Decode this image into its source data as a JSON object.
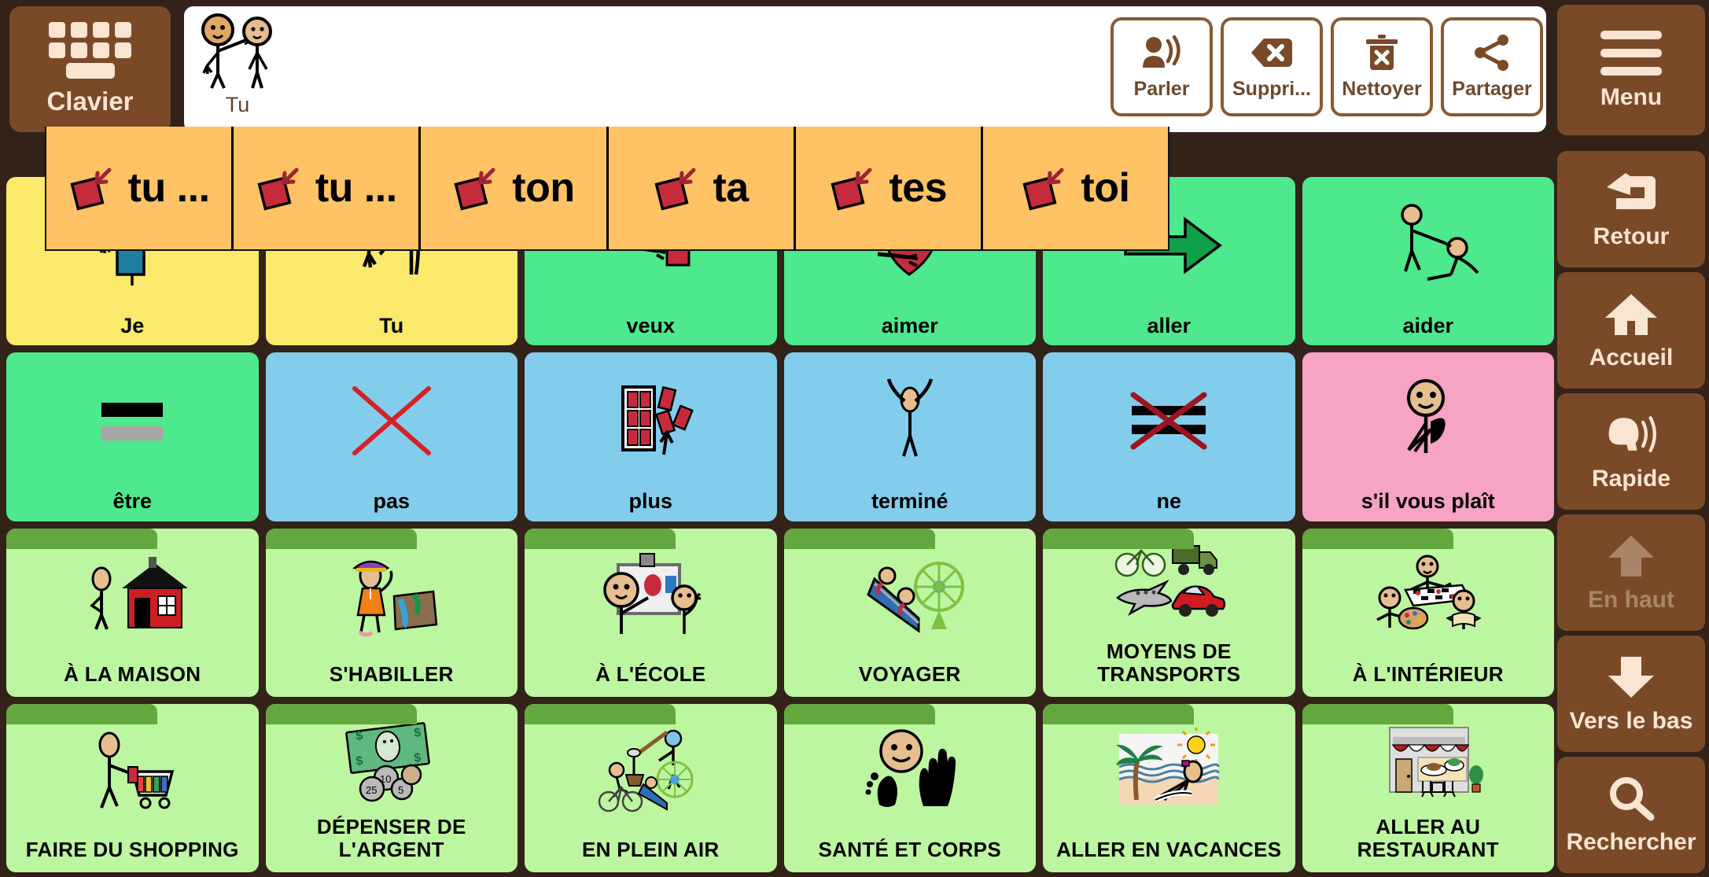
{
  "keyboard_button": {
    "label": "Clavier",
    "icon": "keyboard-icon"
  },
  "sentence_bar": {
    "items": [
      {
        "label": "Tu",
        "icon": "two-people-pointing-icon"
      }
    ]
  },
  "toolbar": {
    "buttons": [
      {
        "label": "Parler",
        "icon": "speak-person-icon"
      },
      {
        "label": "Suppri...",
        "icon": "backspace-delete-icon"
      },
      {
        "label": "Nettoyer",
        "icon": "trash-clear-icon"
      },
      {
        "label": "Partager",
        "icon": "share-icon"
      }
    ]
  },
  "prediction_bar": {
    "background": "#ffc265",
    "items": [
      {
        "label": "tu ...",
        "icon": "red-diamond-arrow-icon"
      },
      {
        "label": "tu ...",
        "icon": "red-diamond-arrow-icon"
      },
      {
        "label": "ton",
        "icon": "red-diamond-arrow-icon"
      },
      {
        "label": "ta",
        "icon": "red-diamond-arrow-icon"
      },
      {
        "label": "tes",
        "icon": "red-diamond-arrow-icon"
      },
      {
        "label": "toi",
        "icon": "red-diamond-arrow-icon"
      }
    ]
  },
  "grid": {
    "columns": 6,
    "rows": 4,
    "cells": [
      {
        "label": "Je",
        "color": "#fbe96b",
        "type": "word",
        "icon": "person-blue-shirt-icon"
      },
      {
        "label": "Tu",
        "color": "#fbe96b",
        "type": "word",
        "icon": "two-stick-arms-icon"
      },
      {
        "label": "veux",
        "color": "#4ee88d",
        "type": "word",
        "icon": "hands-reaching-red-block-icon"
      },
      {
        "label": "aimer",
        "color": "#4ee88d",
        "type": "word",
        "icon": "hands-hugging-heart-icon"
      },
      {
        "label": "aller",
        "color": "#4ee88d",
        "type": "word",
        "icon": "green-right-arrow-icon"
      },
      {
        "label": "aider",
        "color": "#4ee88d",
        "type": "word",
        "icon": "person-helping-person-icon"
      },
      {
        "label": "être",
        "color": "#4ee88d",
        "type": "word",
        "icon": "two-bars-equals-icon"
      },
      {
        "label": "pas",
        "color": "#82cdec",
        "type": "word",
        "icon": "red-x-cross-icon"
      },
      {
        "label": "plus",
        "color": "#82cdec",
        "type": "word",
        "icon": "blocks-adding-icon"
      },
      {
        "label": "terminé",
        "color": "#82cdec",
        "type": "word",
        "icon": "person-arms-up-icon"
      },
      {
        "label": "ne",
        "color": "#82cdec",
        "type": "word",
        "icon": "bars-crossed-out-icon"
      },
      {
        "label": "s'il vous plaît",
        "color": "#f7a3c3",
        "type": "word",
        "icon": "person-please-gesture-icon"
      },
      {
        "label": "À LA MAISON",
        "color": "#bdf6a0",
        "type": "folder",
        "icon": "house-with-person-icon"
      },
      {
        "label": "S'HABILLER",
        "color": "#bdf6a0",
        "type": "folder",
        "icon": "woman-dressing-clothes-icon"
      },
      {
        "label": "À L'ÉCOLE",
        "color": "#bdf6a0",
        "type": "folder",
        "icon": "classroom-whiteboard-icon"
      },
      {
        "label": "VOYAGER",
        "color": "#bdf6a0",
        "type": "folder",
        "icon": "rollercoaster-ferris-wheel-icon"
      },
      {
        "label": "MOYENS DE TRANSPORTS",
        "color": "#bdf6a0",
        "type": "folder",
        "icon": "vehicles-bike-truck-plane-car-icon"
      },
      {
        "label": "À L'INTÉRIEUR",
        "color": "#bdf6a0",
        "type": "folder",
        "icon": "indoor-games-painting-reading-icon"
      },
      {
        "label": "FAIRE DU SHOPPING",
        "color": "#bdf6a0",
        "type": "folder",
        "icon": "person-shopping-cart-icon"
      },
      {
        "label": "DÉPENSER DE L'ARGENT",
        "color": "#bdf6a0",
        "type": "folder",
        "icon": "money-bill-coins-icon"
      },
      {
        "label": "EN PLEIN AIR",
        "color": "#bdf6a0",
        "type": "folder",
        "icon": "outdoor-sports-bike-icon"
      },
      {
        "label": "SANTÉ ET CORPS",
        "color": "#bdf6a0",
        "type": "folder",
        "icon": "face-foot-hand-icon"
      },
      {
        "label": "ALLER EN VACANCES",
        "color": "#bdf6a0",
        "type": "folder",
        "icon": "beach-palm-sun-icon"
      },
      {
        "label": "ALLER AU RESTAURANT",
        "color": "#bdf6a0",
        "type": "folder",
        "icon": "restaurant-storefront-icon"
      }
    ]
  },
  "sidebar": {
    "items": [
      {
        "label": "Menu",
        "icon": "hamburger-menu-icon",
        "disabled": false
      },
      {
        "label": "Retour",
        "icon": "back-arrow-icon",
        "disabled": false
      },
      {
        "label": "Accueil",
        "icon": "home-icon",
        "disabled": false
      },
      {
        "label": "Rapide",
        "icon": "speaking-head-icon",
        "disabled": false
      },
      {
        "label": "En haut",
        "icon": "arrow-up-icon",
        "disabled": true
      },
      {
        "label": "Vers le bas",
        "icon": "arrow-down-icon",
        "disabled": false
      },
      {
        "label": "Rechercher",
        "icon": "search-icon",
        "disabled": false
      }
    ]
  }
}
